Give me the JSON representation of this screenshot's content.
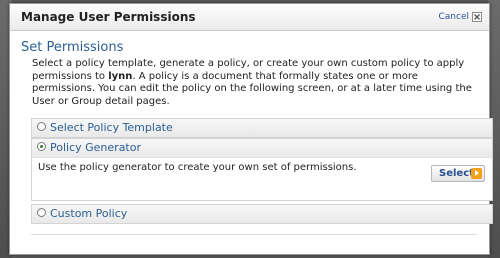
{
  "dialog": {
    "title": "Manage User Permissions",
    "cancel_label": "Cancel",
    "close_icon": "close-icon"
  },
  "section": {
    "title": "Set Permissions",
    "intro_before_user": "Select a policy template, generate a policy, or create your own custom policy to apply permissions to ",
    "user": "lynn",
    "intro_after_user": ". A policy is a document that formally states one or more permissions. You can edit the policy on the following screen, or at a later time using the User or Group detail pages."
  },
  "options": [
    {
      "label": "Select Policy Template",
      "selected": false
    },
    {
      "label": "Policy Generator",
      "selected": true,
      "description": "Use the policy generator to create your own set of permissions.",
      "button_label": "Select"
    },
    {
      "label": "Custom Policy",
      "selected": false
    }
  ],
  "colors": {
    "accent": "#2b5f91",
    "button_arrow": "#f2a119"
  }
}
